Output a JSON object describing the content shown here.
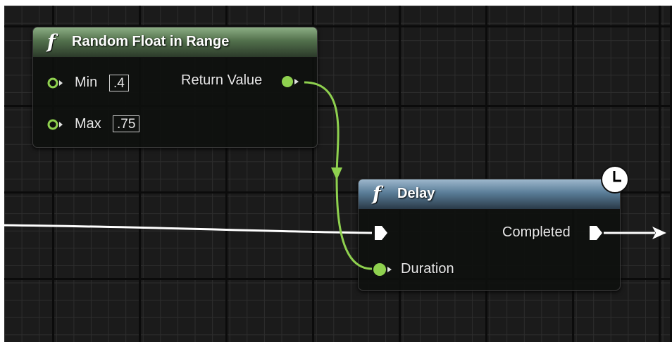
{
  "graph": {
    "wire_colors": {
      "exec": "#ffffff",
      "float": "#8fd14f"
    },
    "nodes": {
      "random_float": {
        "title": "Random Float in Range",
        "header_color": "#52704c",
        "inputs": [
          {
            "label": "Min",
            "value": ".4"
          },
          {
            "label": "Max",
            "value": ".75"
          }
        ],
        "output": {
          "label": "Return Value"
        }
      },
      "delay": {
        "title": "Delay",
        "header_color": "#5a7d98",
        "latent_icon": "clock-icon",
        "inputs": [
          {
            "label": "Duration"
          }
        ],
        "output": {
          "label": "Completed"
        }
      }
    }
  }
}
